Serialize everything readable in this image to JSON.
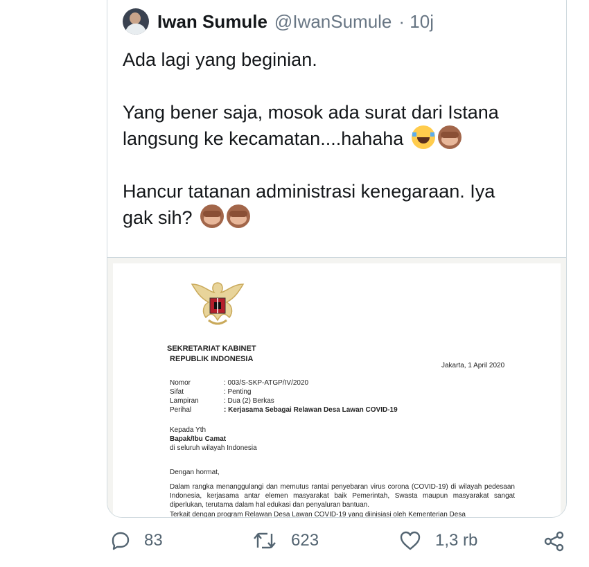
{
  "tweet": {
    "author_name": "Iwan Sumule",
    "handle": "@IwanSumule",
    "time": "· 10j",
    "lines": [
      "Ada lagi yang beginian.",
      "Yang bener saja, mosok ada surat dari Istana",
      "langsung ke kecamatan....hahaha",
      "Hancur tatanan administrasi kenegaraan. Iya",
      "gak sih?"
    ]
  },
  "document": {
    "org_line1": "SEKRETARIAT KABINET",
    "org_line2": "REPUBLIK INDONESIA",
    "date": "Jakarta, 1 April 2020",
    "meta": [
      {
        "key": "Nomor",
        "value": ": 003/S-SKP-ATGP/IV/2020"
      },
      {
        "key": "Sifat",
        "value": ": Penting"
      },
      {
        "key": "Lampiran",
        "value": ": Dua (2) Berkas"
      },
      {
        "key": "Perihal",
        "value": ": Kerjasama Sebagai Relawan Desa Lawan COVID-19"
      }
    ],
    "to_line1": "Kepada Yth",
    "to_line2": "Bapak/Ibu Camat",
    "to_line3": "di seluruh wilayah Indonesia",
    "greeting": "Dengan hormat,",
    "paragraph": "Dalam rangka menanggulangi dan memutus rantai penyebaran virus corona (COVID-19) di wilayah pedesaan Indonesia, kerjasama antar elemen masyarakat baik Pemerintah, Swasta maupun masyarakat sangat diperlukan, terutama dalam hal edukasi dan penyaluran bantuan.",
    "paragraph2_partial": "Terkait dengan program Relawan Desa Lawan COVID-19 yang diinisiasi oleh Kementerian Desa"
  },
  "actions": {
    "reply_count": "83",
    "retweet_count": "623",
    "like_count": "1,3 rb"
  },
  "icons": {
    "reply": "reply-icon",
    "retweet": "retweet-icon",
    "like": "heart-icon",
    "share": "share-icon"
  },
  "colors": {
    "text": "#14171a",
    "secondary": "#687684",
    "border": "#cfd9de"
  }
}
